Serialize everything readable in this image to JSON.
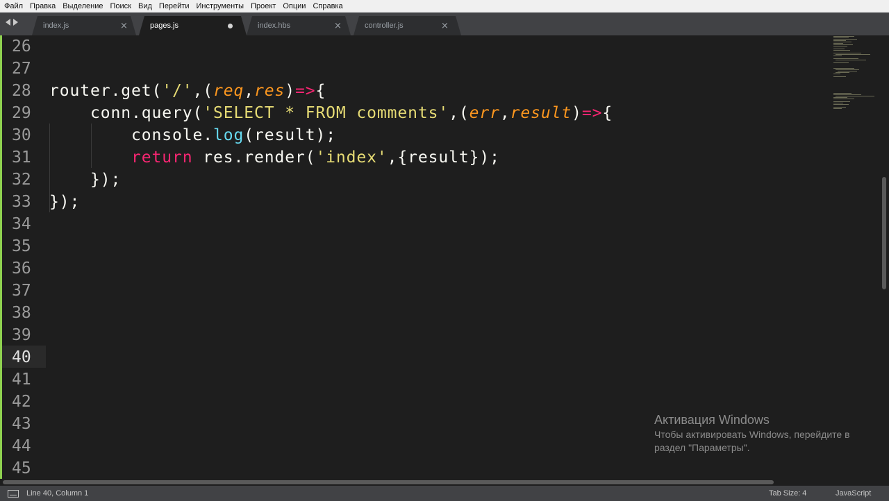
{
  "menu": [
    "Файл",
    "Правка",
    "Выделение",
    "Поиск",
    "Вид",
    "Перейти",
    "Инструменты",
    "Проект",
    "Опции",
    "Справка"
  ],
  "tabs": [
    {
      "label": "index.js",
      "active": false,
      "modified": false
    },
    {
      "label": "pages.js",
      "active": true,
      "modified": true
    },
    {
      "label": "index.hbs",
      "active": false,
      "modified": false
    },
    {
      "label": "controller.js",
      "active": false,
      "modified": false
    }
  ],
  "editor": {
    "line_numbers": [
      "26",
      "27",
      "28",
      "29",
      "30",
      "31",
      "32",
      "33",
      "34",
      "35",
      "36",
      "37",
      "38",
      "39",
      "40",
      "41",
      "42",
      "43",
      "44",
      "45"
    ],
    "current_line": "40",
    "code": [
      {
        "line": "28",
        "tokens": [
          {
            "t": "router.get(",
            "c": "plain"
          },
          {
            "t": "'/'",
            "c": "str"
          },
          {
            "t": ",(",
            "c": "plain"
          },
          {
            "t": "req",
            "c": "param"
          },
          {
            "t": ",",
            "c": "plain"
          },
          {
            "t": "res",
            "c": "param"
          },
          {
            "t": ")",
            "c": "plain"
          },
          {
            "t": "=>",
            "c": "op"
          },
          {
            "t": "{",
            "c": "plain"
          }
        ]
      },
      {
        "line": "29",
        "tokens": [
          {
            "t": "    conn.query(",
            "c": "plain"
          },
          {
            "t": "'SELECT * FROM comments'",
            "c": "str"
          },
          {
            "t": ",(",
            "c": "plain"
          },
          {
            "t": "err",
            "c": "param"
          },
          {
            "t": ",",
            "c": "plain"
          },
          {
            "t": "result",
            "c": "param"
          },
          {
            "t": ")",
            "c": "plain"
          },
          {
            "t": "=>",
            "c": "op"
          },
          {
            "t": "{",
            "c": "plain"
          }
        ]
      },
      {
        "line": "30",
        "tokens": [
          {
            "t": "        console.",
            "c": "plain"
          },
          {
            "t": "log",
            "c": "fn"
          },
          {
            "t": "(result);",
            "c": "plain"
          }
        ]
      },
      {
        "line": "31",
        "tokens": [
          {
            "t": "        ",
            "c": "plain"
          },
          {
            "t": "return",
            "c": "kw"
          },
          {
            "t": " res.render(",
            "c": "plain"
          },
          {
            "t": "'index'",
            "c": "str"
          },
          {
            "t": ",{result});",
            "c": "plain"
          }
        ]
      },
      {
        "line": "32",
        "tokens": [
          {
            "t": "    });",
            "c": "plain"
          }
        ]
      },
      {
        "line": "33",
        "tokens": [
          {
            "t": "});",
            "c": "plain"
          }
        ]
      }
    ]
  },
  "status": {
    "position": "Line 40, Column 1",
    "tab_size": "Tab Size: 4",
    "syntax": "JavaScript"
  },
  "watermark": {
    "title": "Активация Windows",
    "line1": "Чтобы активировать Windows, перейдите в",
    "line2": "раздел \"Параметры\"."
  },
  "colors": {
    "background": "#1e1e1e",
    "gutter_marker": "#8fd14f",
    "string": "#e6db74",
    "keyword": "#f92672",
    "function": "#66d9ef",
    "parameter": "#fd971f",
    "text": "#f8f8f2"
  }
}
